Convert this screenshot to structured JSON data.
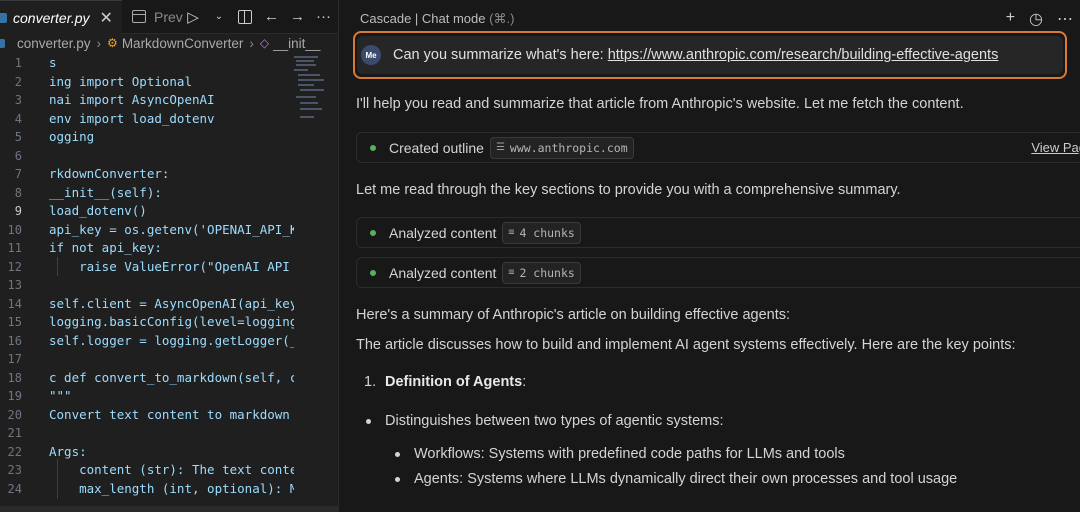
{
  "editor": {
    "tab_label": "converter.py",
    "tab_close": "✕",
    "preview_label": "Prev",
    "breadcrumb": [
      "converter.py",
      "MarkdownConverter",
      "__init__"
    ],
    "line_numbers": [
      "1",
      "2",
      "3",
      "4",
      "5",
      "6",
      "7",
      "8",
      "9",
      "10",
      "11",
      "12",
      "13",
      "14",
      "15",
      "16",
      "17",
      "18",
      "19",
      "20",
      "21",
      "22",
      "23",
      "24"
    ],
    "active_line": "9",
    "code_lines": [
      "s",
      "ing import Optional",
      "nai import AsyncOpenAI",
      "env import load_dotenv",
      "ogging",
      "",
      "rkdownConverter:",
      "__init__(self):",
      "load_dotenv()",
      "api_key = os.getenv('OPENAI_API_K",
      "if not api_key:",
      "    raise ValueError(\"OpenAI API",
      "",
      "self.client = AsyncOpenAI(api_key",
      "logging.basicConfig(level=logging",
      "self.logger = logging.getLogger(_",
      "",
      "c def convert_to_markdown(self, c",
      "\"\"\"",
      "Convert text content to markdown",
      "",
      "Args:",
      "    content (str): The text conte",
      "    max_length (int, optional): M"
    ]
  },
  "cascade": {
    "title": "Cascade | Chat mode",
    "shortcut": "(⌘.)",
    "header_icons": [
      "plus-icon",
      "history-icon",
      "more-icon"
    ],
    "user": {
      "avatar": "Me",
      "text": "Can you summarize what's here: ",
      "link": "https://www.anthropic.com/research/building-effective-agents"
    },
    "intro": "I'll help you read and summarize that article from Anthropic's website. Let me fetch the content.",
    "step1": {
      "label": "Created outline",
      "chip": "www.anthropic.com",
      "link": "View Pag"
    },
    "reading": "Let me read through the key sections to provide you with a comprehensive summary.",
    "step2": {
      "label": "Analyzed content",
      "chip": "4 chunks"
    },
    "step3": {
      "label": "Analyzed content",
      "chip": "2 chunks"
    },
    "summary_intro": "Here's a summary of Anthropic's article on building effective agents:",
    "summary_desc": "The article discusses how to build and implement AI agent systems effectively. Here are the key points:",
    "point1_num": "1.",
    "point1_title": "Definition of Agents",
    "point1_colon": ":",
    "bullet1": "Distinguishes between two types of agentic systems:",
    "sub1": "Workflows: Systems with predefined code paths for LLMs and tools",
    "sub2": "Agents: Systems where LLMs dynamically direct their own processes and tool usage"
  }
}
